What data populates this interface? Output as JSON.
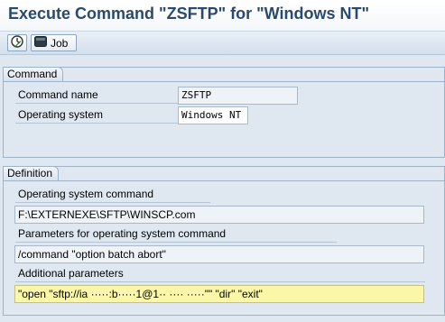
{
  "window": {
    "title": "Execute Command \"ZSFTP\" for \"Windows NT\""
  },
  "toolbar": {
    "execute_icon": "execute-clock-icon",
    "job_icon": "background-job-icon",
    "job_label": "Job"
  },
  "command_group": {
    "title": "Command",
    "command_name_label": "Command name",
    "command_name_value": "ZSFTP",
    "os_label": "Operating system",
    "os_value": "Windows NT"
  },
  "definition_group": {
    "title": "Definition",
    "os_command_label": "Operating system command",
    "os_command_value": "F:\\EXTERNEXE\\SFTP\\WINSCP.com",
    "params_label": "Parameters for operating system command",
    "params_value": "/command \"option batch abort\"",
    "additional_label": "Additional parameters",
    "additional_value": "\"open \"sftp://ia ·····:b·····1@1·· ···· ·····\"\"  \"dir\" \"exit\""
  },
  "colors": {
    "title": "#2b4a6b",
    "background": "#dfe8f1",
    "highlight_field": "#fbf7a8"
  }
}
